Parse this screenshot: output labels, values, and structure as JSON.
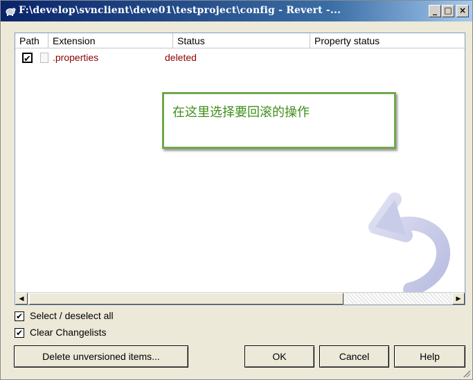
{
  "window": {
    "title": "F:\\develop\\svnclient\\deve01\\testproject\\config - Revert -...",
    "min_glyph": "_",
    "max_glyph": "□",
    "close_glyph": "×"
  },
  "list": {
    "columns": [
      "Path",
      "Extension",
      "Status",
      "Property status"
    ],
    "rows": [
      {
        "checked": "✔",
        "extension": ".properties",
        "status": "deleted",
        "property_status": ""
      }
    ]
  },
  "annotation": {
    "text": "在这里选择要回滚的操作"
  },
  "scrollbar": {
    "left_glyph": "◀",
    "right_glyph": "▶"
  },
  "options": {
    "select_all": {
      "checked": "✔",
      "label": "Select / deselect all"
    },
    "clear_changelists": {
      "checked": "✔",
      "label": "Clear Changelists"
    }
  },
  "buttons": {
    "delete_unversioned": "Delete unversioned items...",
    "ok": "OK",
    "cancel": "Cancel",
    "help": "Help"
  },
  "colors": {
    "status_deleted": "#8b0000",
    "annotation_border": "#6fa84a",
    "annotation_text": "#3e8f1a"
  }
}
